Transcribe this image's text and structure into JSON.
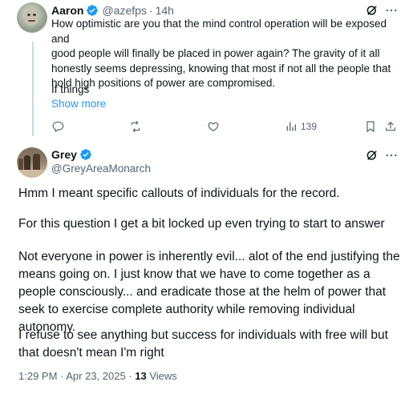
{
  "parent": {
    "name": "Aaron",
    "handle": "@azefps",
    "time": "14h",
    "text_lines": [
      "How optimistic are you that the mind control operation will be exposed and",
      "good people will finally be placed in power again? The gravity of it all",
      "honestly seems depressing, knowing that most if not all the people that",
      "hold high positions of power are compromised."
    ],
    "text_more": "If things",
    "show_more": "Show more",
    "views": "139"
  },
  "main": {
    "name": "Grey",
    "handle": "@GreyAreaMonarch",
    "paragraphs": [
      "Hmm I meant specific callouts of individuals for the record.",
      "For this question I get a bit locked up even trying to start to answer",
      "Not everyone in power is inherently evil... alot of the end justifying the means going on. I just know that we have to come together as a people consciously... and eradicate those at the helm of power that seek to exercise complete authority while removing individual autonomy.",
      "I refuse to see anything but success for individuals with free will but that doesn't mean I'm right"
    ],
    "timestamp": "1:29 PM · Apr 23, 2025 · ",
    "views_count": "13",
    "views_label": " Views"
  },
  "colors": {
    "accent": "#1d9bf0",
    "secondary_text": "#536471",
    "thread_line": "#cfd9de"
  },
  "icons": [
    "verified-badge-icon",
    "grok-icon",
    "more-icon",
    "reply-icon",
    "retweet-icon",
    "like-icon",
    "views-icon",
    "bookmark-icon",
    "share-icon"
  ]
}
